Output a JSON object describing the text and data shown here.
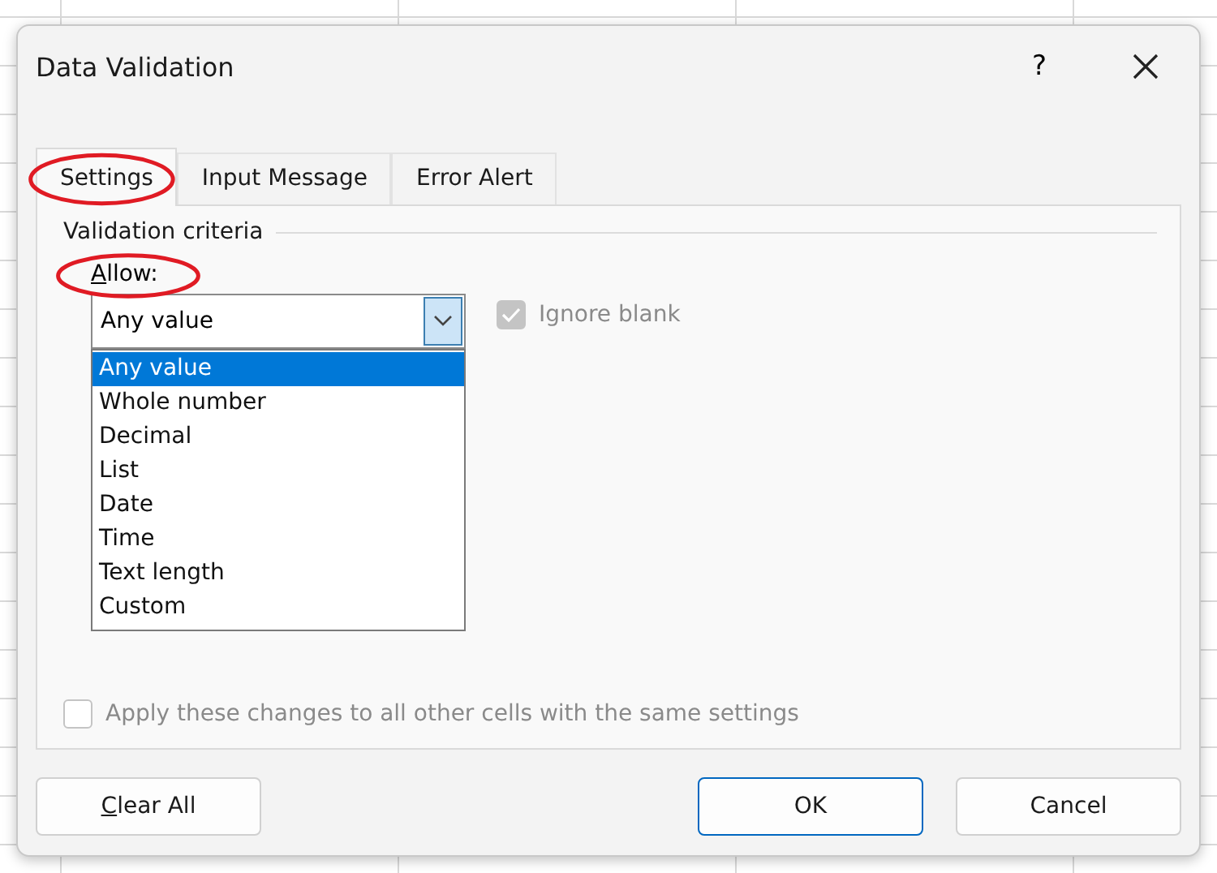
{
  "window": {
    "title": "Data Validation",
    "help": "?"
  },
  "tabs": [
    {
      "label": "Settings",
      "selected": true,
      "highlighted": true
    },
    {
      "label": "Input Message",
      "selected": false,
      "highlighted": false
    },
    {
      "label": "Error Alert",
      "selected": false,
      "highlighted": false
    }
  ],
  "group": {
    "title": "Validation criteria"
  },
  "allow": {
    "label": "Allow:",
    "highlighted": true,
    "value": "Any value",
    "expanded": true,
    "options": [
      {
        "label": "Any value",
        "selected": true
      },
      {
        "label": "Whole number",
        "selected": false
      },
      {
        "label": "Decimal",
        "selected": false
      },
      {
        "label": "List",
        "selected": false
      },
      {
        "label": "Date",
        "selected": false
      },
      {
        "label": "Time",
        "selected": false
      },
      {
        "label": "Text length",
        "selected": false
      },
      {
        "label": "Custom",
        "selected": false
      }
    ]
  },
  "ignore_blank": {
    "label": "Ignore blank",
    "checked": true,
    "disabled": true
  },
  "apply_all": {
    "label": "Apply these changes to all other cells with the same settings",
    "checked": false,
    "disabled": true
  },
  "buttons": [
    {
      "label": "Clear All",
      "kind": "left",
      "default": false
    },
    {
      "label": "OK",
      "kind": "right",
      "default": true
    },
    {
      "label": "Cancel",
      "kind": "right",
      "default": false
    }
  ]
}
